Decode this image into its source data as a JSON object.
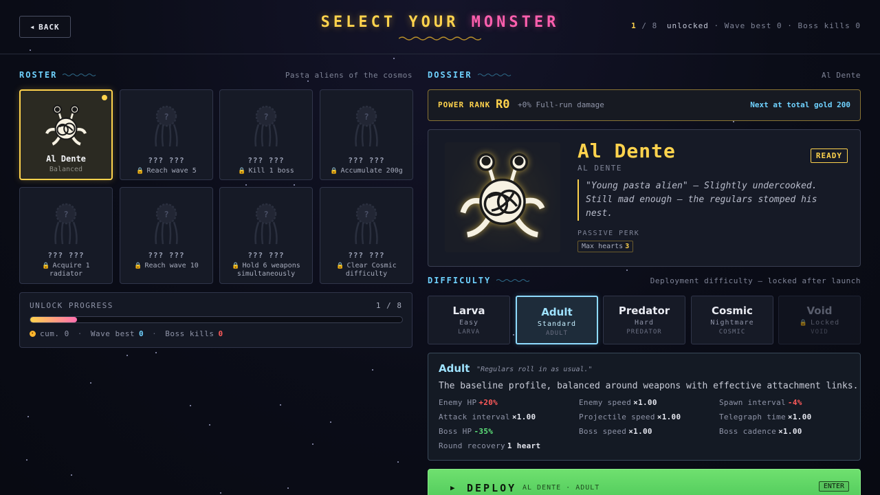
{
  "header": {
    "back_label": "BACK",
    "title_part1": "SELECT YOUR",
    "title_part2": "MONSTER",
    "unlocked_count": "1",
    "unlocked_total": "/ 8",
    "unlocked_word": "unlocked",
    "wave_best": "Wave best 0",
    "boss_kills": "Boss kills 0"
  },
  "roster": {
    "heading": "ROSTER",
    "note": "Pasta aliens of the cosmos",
    "cards": [
      {
        "name": "Al Dente",
        "sub": "Balanced",
        "selected": true,
        "locked": false
      },
      {
        "name": "??? ???",
        "sub": "Reach wave 5",
        "locked": true
      },
      {
        "name": "??? ???",
        "sub": "Kill 1 boss",
        "locked": true
      },
      {
        "name": "??? ???",
        "sub": "Accumulate 200g",
        "locked": true
      },
      {
        "name": "??? ???",
        "sub": "Acquire 1 radiator",
        "locked": true
      },
      {
        "name": "??? ???",
        "sub": "Reach wave 10",
        "locked": true
      },
      {
        "name": "??? ???",
        "sub": "Hold 6 weapons simultaneously",
        "locked": true
      },
      {
        "name": "??? ???",
        "sub": "Clear Cosmic difficulty",
        "locked": true
      }
    ]
  },
  "unlock_progress": {
    "title": "UNLOCK PROGRESS",
    "count": "1 / 8",
    "fraction": 0.125,
    "cum_label": "cum. 0",
    "wave_label": "Wave best",
    "wave_value": "0",
    "boss_label": "Boss kills",
    "boss_value": "0"
  },
  "dossier": {
    "heading": "DOSSIER",
    "note": "Al Dente",
    "power_label": "POWER RANK",
    "power_rank": "R0",
    "power_desc": "+0% Full-run damage",
    "power_next": "Next at total gold 200",
    "name": "Al Dente",
    "code": "AL DENTE",
    "status": "READY",
    "quote": "\"Young pasta alien\" — Slightly undercooked. Still mad enough — the regulars stomped his nest.",
    "perk_label": "PASSIVE PERK",
    "perk_name": "Max hearts",
    "perk_value": "3"
  },
  "difficulty": {
    "heading": "DIFFICULTY",
    "note": "Deployment difficulty — locked after launch",
    "options": [
      {
        "name": "Larva",
        "sub": "Easy",
        "tag": "LARVA"
      },
      {
        "name": "Adult",
        "sub": "Standard",
        "tag": "ADULT"
      },
      {
        "name": "Predator",
        "sub": "Hard",
        "tag": "PREDATOR"
      },
      {
        "name": "Cosmic",
        "sub": "Nightmare",
        "tag": "COSMIC"
      },
      {
        "name": "Void",
        "sub": "Locked",
        "tag": "VOID"
      }
    ],
    "selected": "Adult",
    "detail": {
      "name": "Adult",
      "quote": "\"Regulars roll in as usual.\"",
      "desc": "The baseline profile, balanced around weapons with effective attachment links.",
      "stats": [
        {
          "label": "Enemy HP",
          "value": "+20%",
          "tone": "red"
        },
        {
          "label": "Enemy speed",
          "value": "×1.00",
          "tone": "neutral"
        },
        {
          "label": "Spawn interval",
          "value": "-4%",
          "tone": "red"
        },
        {
          "label": "Attack interval",
          "value": "×1.00",
          "tone": "neutral"
        },
        {
          "label": "Projectile speed",
          "value": "×1.00",
          "tone": "neutral"
        },
        {
          "label": "Telegraph time",
          "value": "×1.00",
          "tone": "neutral"
        },
        {
          "label": "Boss HP",
          "value": "-35%",
          "tone": "green"
        },
        {
          "label": "Boss speed",
          "value": "×1.00",
          "tone": "neutral"
        },
        {
          "label": "Boss cadence",
          "value": "×1.00",
          "tone": "neutral"
        },
        {
          "label": "Round recovery",
          "value": "1 heart",
          "tone": "neutral"
        }
      ]
    }
  },
  "deploy": {
    "label": "DEPLOY",
    "sub": "AL DENTE · ADULT",
    "key": "ENTER"
  },
  "colors": {
    "accent_gold": "#ffd34d",
    "accent_pink": "#ff5fae",
    "accent_cyan": "#6fd2ff",
    "deploy_green": "#5fd565",
    "danger_red": "#ff5a5a",
    "good_green": "#5ee37a"
  }
}
